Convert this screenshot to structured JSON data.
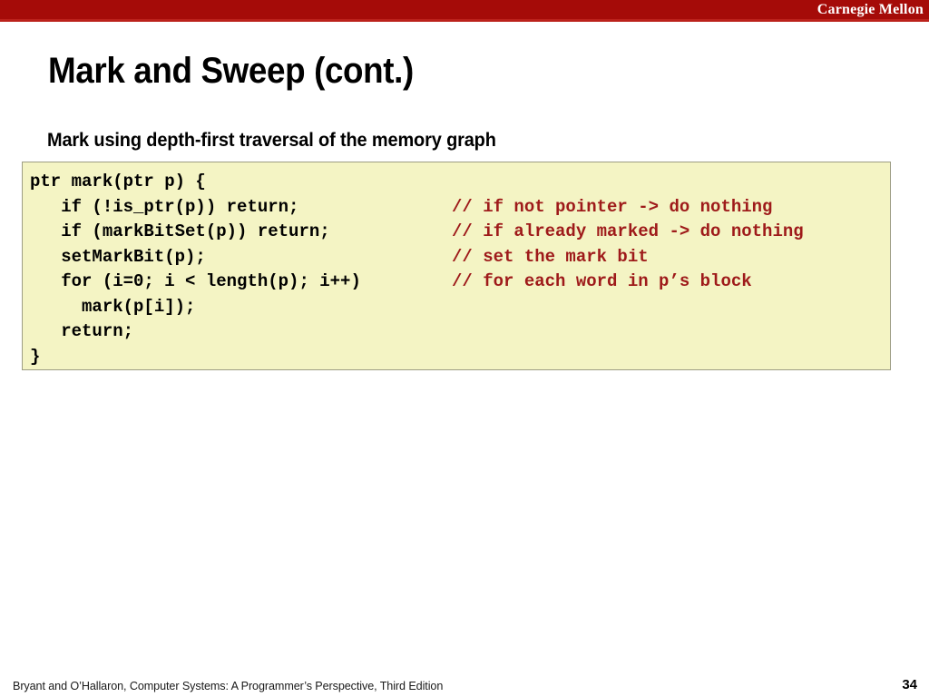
{
  "banner": {
    "brand": "Carnegie Mellon",
    "bg_color": "#a50b08",
    "underline_color": "#bb211b"
  },
  "slide": {
    "title": "Mark and Sweep (cont.)",
    "subtitle": "Mark using depth-first traversal of the memory graph"
  },
  "code_block": {
    "background_color": "#f4f4c4",
    "border_color": "#9d9d84",
    "code_color": "#000000",
    "comment_color": "#9e1a1a",
    "lines": [
      {
        "code": "ptr mark(ptr p) {",
        "comment": ""
      },
      {
        "code": "   if (!is_ptr(p)) return;",
        "comment": "// if not pointer -> do nothing"
      },
      {
        "code": "   if (markBitSet(p)) return;",
        "comment": "// if already marked -> do nothing"
      },
      {
        "code": "   setMarkBit(p);",
        "comment": "// set the mark bit"
      },
      {
        "code": "   for (i=0; i < length(p); i++)",
        "comment": "// for each word in p’s block"
      },
      {
        "code": "     mark(p[i]);",
        "comment": ""
      },
      {
        "code": "   return;",
        "comment": ""
      },
      {
        "code": "}",
        "comment": ""
      }
    ]
  },
  "footer": {
    "attribution": "Bryant and O’Hallaron, Computer Systems: A Programmer’s Perspective, Third Edition",
    "page_number": "34"
  }
}
